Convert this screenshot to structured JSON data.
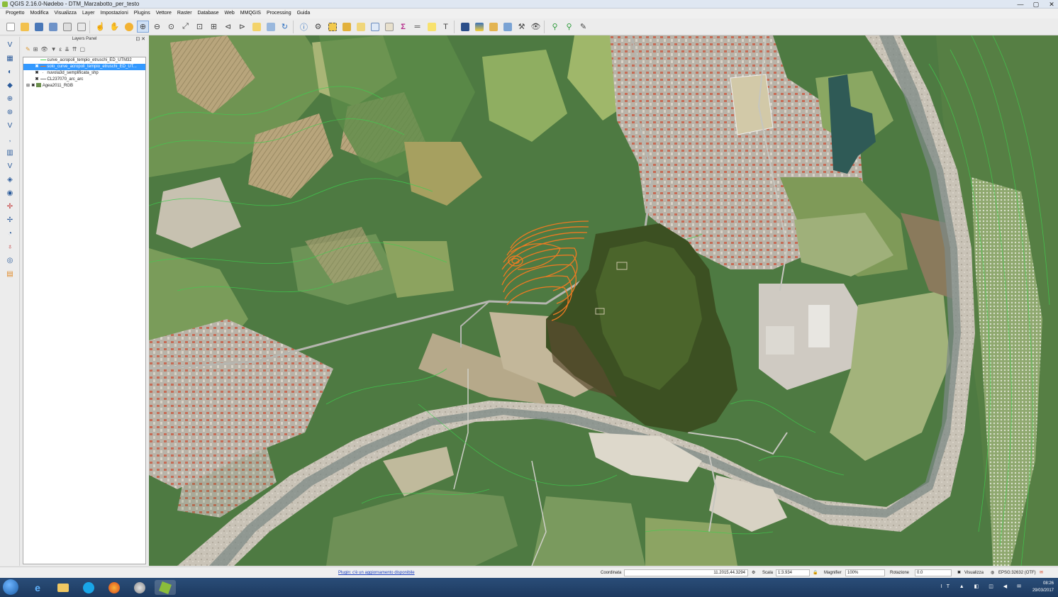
{
  "window": {
    "title": "QGIS 2.16.0-Nødebo - DTM_Marzabotto_per_testo",
    "min": "—",
    "max": "▢",
    "close": "✕"
  },
  "menu": [
    "Progetto",
    "Modifica",
    "Visualizza",
    "Layer",
    "Impostazioni",
    "Plugins",
    "Vettore",
    "Raster",
    "Database",
    "Web",
    "MMQGIS",
    "Processing",
    "Guida"
  ],
  "layers_panel": {
    "title": "Layers Panel",
    "controls": "⊡ ✕",
    "layers": [
      {
        "name": "curve_acropoli_tempio_etruschi_ED_UTM32",
        "checked": false,
        "selected": false
      },
      {
        "name": "solo_curve_acropoli_tempio_etruschi_ED_UT...",
        "checked": true,
        "selected": true
      },
      {
        "name": "nuvola3d_semplificata_shp",
        "checked": true,
        "selected": false
      },
      {
        "name": "CL237070_arc_arc",
        "checked": true,
        "selected": false
      },
      {
        "name": "Agea2011_RGB",
        "checked": true,
        "selected": false
      }
    ]
  },
  "status": {
    "message": "Plugin: c'è un aggiornamento disponibile",
    "coord_label": "Coordinata",
    "coord_value": "11.2015,44.3294",
    "scale_label": "Scala",
    "scale_value": "1:3.934",
    "magnifier_label": "Magnifier",
    "magnifier_value": "100%",
    "rotation_label": "Rotazione",
    "rotation_value": "0.0",
    "render_label": "Visualizza",
    "crs": "EPSG:32632 (OTF)"
  },
  "taskbar": {
    "lang": "IT",
    "time": "08:26",
    "date": "29/03/2017"
  },
  "colors": {
    "contour_orange": "#ee7a22",
    "contour_green": "#3fcf4f",
    "selection": "#3399ff"
  }
}
